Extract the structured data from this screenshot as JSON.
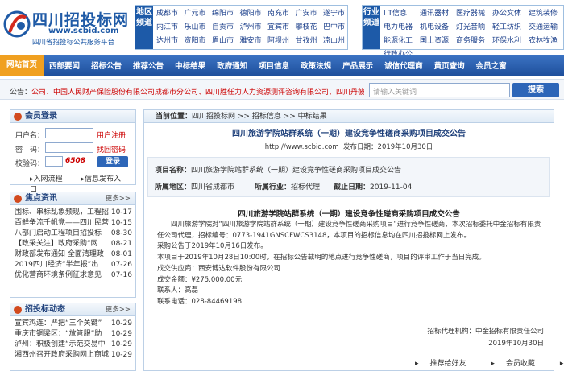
{
  "logo": {
    "title": "四川招投标网",
    "domain": "www.scbid.com",
    "subtitle": "四川省招投标公共服务平台"
  },
  "region": {
    "label": "地区频道",
    "items": [
      "成都市",
      "广元市",
      "绵阳市",
      "德阳市",
      "南充市",
      "广安市",
      "遂宁市",
      "内江市",
      "乐山市",
      "自贡市",
      "泸州市",
      "宜宾市",
      "攀枝花",
      "巴中市",
      "达州市",
      "资阳市",
      "眉山市",
      "雅安市",
      "阿坝州",
      "甘孜州",
      "凉山州"
    ]
  },
  "industry": {
    "label": "行业频道",
    "items": [
      "I T信息",
      "通讯器材",
      "医疗器械",
      "办公文体",
      "建筑装修",
      "电力电器",
      "机电设备",
      "灯光音响",
      "轻工纺织",
      "交通运输",
      "能源化工",
      "国土资源",
      "商务服务",
      "环保水利",
      "农林牧渔",
      "行政办公"
    ]
  },
  "mainnav": [
    "网站首页",
    "西部要闻",
    "招标公告",
    "推荐公告",
    "中标结果",
    "政府通知",
    "项目信息",
    "政策法规",
    "产品展示",
    "诚信代理商",
    "黄页查询",
    "会员之窗"
  ],
  "notice": {
    "prefix": "公告：",
    "text": "公司、中国人民财产保险股份有限公司成都市分公司、四川胜任力人力资源测评咨询有限公司、四川丹彼"
  },
  "search": {
    "placeholder": "请输入关键词",
    "button": "搜索"
  },
  "login": {
    "title": "会员登录",
    "username_label": "用户名：",
    "password_label": "密　码：",
    "code_label": "校验码：",
    "code_value": "6508",
    "register": "用户注册",
    "forgot": "找回密码",
    "login_btn": "登录",
    "join": "入网流程",
    "publish": "信息发布入口"
  },
  "news": {
    "title": "焦点资讯",
    "more": "更多>>",
    "items": [
      {
        "t": "围标、串标乱象频现，工程招",
        "d": "10-17"
      },
      {
        "t": "百鲜争流千帆竞——四川民营",
        "d": "10-15"
      },
      {
        "t": "八部门启动工程项目招投标",
        "d": "08-30"
      },
      {
        "t": "【政采关注】政府采购“网",
        "d": "08-21"
      },
      {
        "t": "财政部发布通知 全面清理政",
        "d": "08-01"
      },
      {
        "t": "2019四川经济“半年报”出",
        "d": "07-26"
      },
      {
        "t": "优化营商环境条例征求意见",
        "d": "07-16"
      }
    ]
  },
  "dyn": {
    "title": "招投标动态",
    "more": "更多>>",
    "items": [
      {
        "t": "宣宾鸡连：严把“三个关键”",
        "d": "10-29"
      },
      {
        "t": "重庆市铜梁区：“放管服”助",
        "d": "10-29"
      },
      {
        "t": "泸州：积极创建“示范交易中",
        "d": "10-29"
      },
      {
        "t": "湘西州召开政府采购网上商城",
        "d": "10-29"
      }
    ]
  },
  "crumb": {
    "label": "当前位置：",
    "path": "四川招投标网 >> 招标信息 >> 中标结果"
  },
  "article": {
    "title": "四川旅游学院站群系统（一期）建设竞争性磋商采购项目成交公告",
    "source": "http://www.scbid.com",
    "date_label": "发布日期：2019年10月30日",
    "project_name_label": "项目名称：",
    "project_name": "四川旅游学院站群系统（一期）建设竞争性磋商采购项目成交公告",
    "region_label": "所属地区：",
    "region": "四川省成都市",
    "industry_label": "所属行业：",
    "industry": "招标代理",
    "deadline_label": "截止日期：",
    "deadline": "2019-11-04",
    "subtitle": "四川旅游学院站群系统（一期）建设竞争性磋商采购项目成交公告",
    "para1": "四川旅游学院对“四川旅游学院站群系统（一期）建设竞争性磋商采购项目”进行竞争性磋商，本次招标委托中金招标有限责任公司代理，招标编号：0773-1941GNSCFWCS3148，本项目的招标信息均在四川招投标网上发布。",
    "line1": "采购公告于2019年10月16日发布。",
    "line2": "本项目于2019年10月28日10:00时，在招标公告载明的地点进行竞争性磋商，项目的评审工作于当日完成。",
    "line3": "成交供应商：西安博达软件股份有限公司",
    "line4": "成交金额：¥275,000.00元",
    "line5": "联系人：高磊",
    "line6": "联系电话：028-84469198",
    "agency": "招标代理机构：中金招标有限责任公司",
    "sign_date": "2019年10月30日",
    "actions": [
      "推荐给好友",
      "会员收藏",
      "关闭"
    ]
  }
}
